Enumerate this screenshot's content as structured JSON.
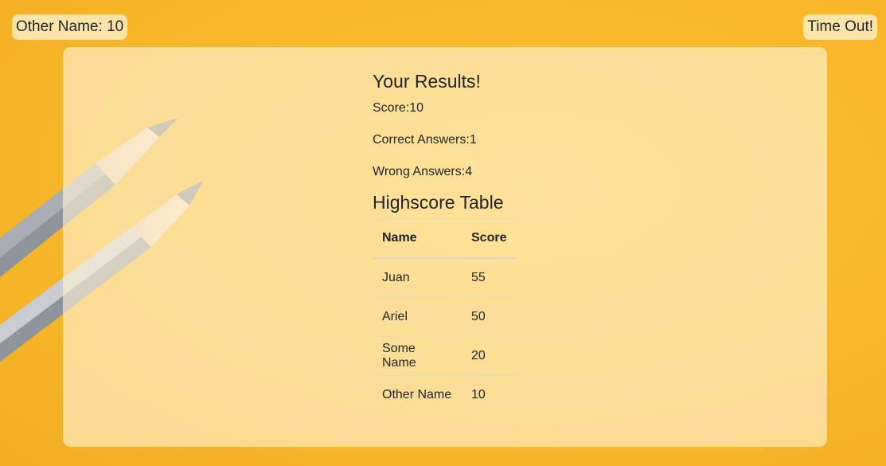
{
  "header": {
    "player_badge": "Other Name: 10",
    "timer_badge": "Time Out!"
  },
  "results": {
    "title": "Your Results!",
    "score_line": "Score:10",
    "correct_line": "Correct Answers:1",
    "wrong_line": "Wrong Answers:4"
  },
  "highscores": {
    "title": "Highscore Table",
    "columns": [
      "Name",
      "Score"
    ],
    "rows": [
      {
        "name": "Juan",
        "score": "55"
      },
      {
        "name": "Ariel",
        "score": "50"
      },
      {
        "name": "Some Name",
        "score": "20"
      },
      {
        "name": "Other Name",
        "score": "10"
      }
    ]
  },
  "colors": {
    "background": "#f8b82a",
    "card_tint": "#fff4d6",
    "text": "#212529"
  }
}
